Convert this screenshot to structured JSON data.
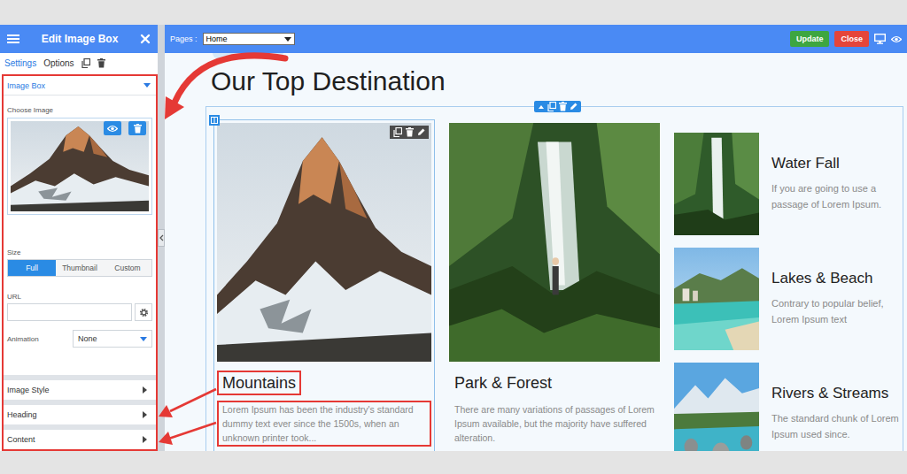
{
  "editor": {
    "title": "Edit Image Box",
    "tabs": [
      {
        "label": "Settings",
        "selected": true
      },
      {
        "label": "Options",
        "selected": false
      }
    ],
    "image_box": {
      "title": "Image Box",
      "expanded": true,
      "choose_image_label": "Choose Image",
      "size_label": "Size",
      "sizes": [
        {
          "label": "Full",
          "selected": true
        },
        {
          "label": "Thumbnail",
          "selected": false
        },
        {
          "label": "Custom",
          "selected": false
        }
      ],
      "url_label": "URL",
      "url_value": "",
      "animation_label": "Animation",
      "animation_value": "None"
    },
    "sections": [
      {
        "title": "Image Style",
        "expanded": false
      },
      {
        "title": "Heading",
        "expanded": false
      },
      {
        "title": "Content",
        "expanded": false
      }
    ]
  },
  "toolbar": {
    "pages_label": "Pages :",
    "page": "Home",
    "buttons": [
      {
        "label": "Update",
        "color": "#3da640"
      },
      {
        "label": "Close",
        "color": "#e5453a"
      }
    ]
  },
  "page": {
    "heading": "Our Top Destination",
    "featured": [
      {
        "title": "Mountains",
        "text": "Lorem Ipsum has been the industry's standard dummy text ever since the 1500s, when an unknown printer took...",
        "selected": true,
        "title_highlighted": true,
        "text_highlighted": true
      },
      {
        "title": "Park & Forest",
        "text": "There are many variations of passages of Lorem Ipsum available, but the majority have suffered alteration.",
        "selected": false,
        "title_highlighted": false,
        "text_highlighted": false
      }
    ],
    "side": [
      {
        "title": "Water Fall",
        "text": "If you are going to use a passage of Lorem Ipsum."
      },
      {
        "title": "Lakes & Beach",
        "text": "Contrary to popular belief, Lorem Ipsum text"
      },
      {
        "title": "Rivers & Streams",
        "text": "The standard chunk of Lorem Ipsum used since."
      }
    ]
  }
}
